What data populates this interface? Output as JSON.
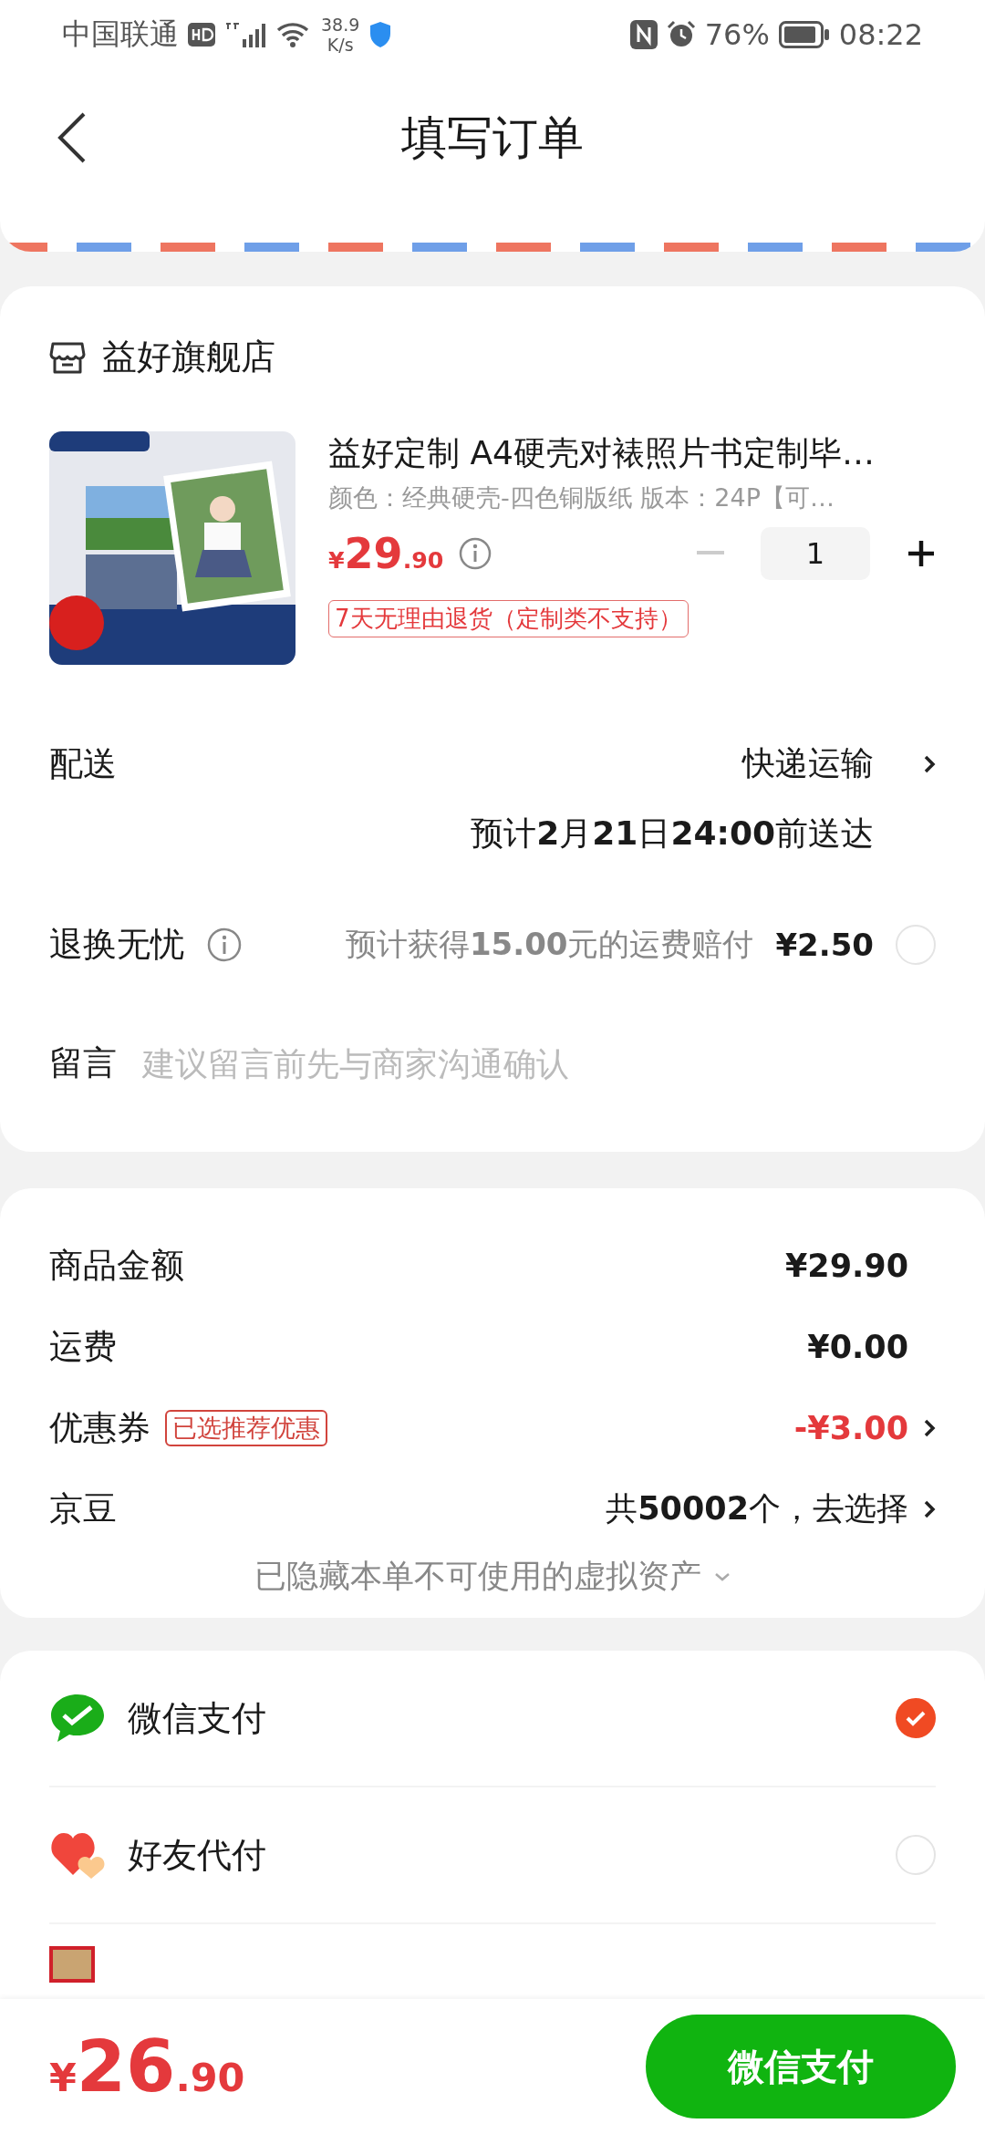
{
  "status_bar": {
    "carrier": "中国联通",
    "speed_value": "38.9",
    "speed_unit": "K/s",
    "battery": "76%",
    "time": "08:22"
  },
  "header": {
    "title": "填写订单"
  },
  "store": {
    "name": "益好旗舰店"
  },
  "product": {
    "kind": "picture",
    "title": "益好定制 A4硬壳对裱照片书定制毕…",
    "spec": "颜色：经典硬壳-四色铜版纸   版本：24P【可…",
    "currency": "¥",
    "price_int": "29",
    "price_dec": ".90",
    "quantity": "1",
    "return_tag": "7天无理由退货（定制类不支持）"
  },
  "delivery": {
    "label": "配送",
    "method": "快递运输",
    "eta": "预计**2**月**21**日**24:00**前送达"
  },
  "insurance": {
    "label": "退换无忧",
    "desc": "预计获得**15.00**元的运费赔付",
    "price": "¥2.50",
    "selected": false
  },
  "message": {
    "label": "留言",
    "placeholder": "建议留言前先与商家沟通确认"
  },
  "summary": [
    {
      "kind": "plain",
      "label": "商品金额",
      "value": "¥29.90",
      "arrow": false
    },
    {
      "kind": "plain",
      "label": "运费",
      "value": "¥0.00",
      "arrow": false
    },
    {
      "kind": "discount",
      "label": "优惠券",
      "tag": "已选推荐优惠",
      "value": "-¥3.00",
      "arrow": true
    },
    {
      "kind": "beans",
      "label": "京豆",
      "value": "共**50002**个，去选择",
      "arrow": true
    }
  ],
  "hidden_note": "已隐藏本单不可使用的虚拟资产",
  "payments": [
    {
      "kind": "wechat",
      "name": "微信支付",
      "selected": true
    },
    {
      "kind": "friend",
      "name": "好友代付",
      "selected": false
    },
    {
      "kind": "jd"
    }
  ],
  "footer": {
    "currency": "¥",
    "total_int": "26",
    "total_dec": ".90",
    "button": "微信支付"
  }
}
